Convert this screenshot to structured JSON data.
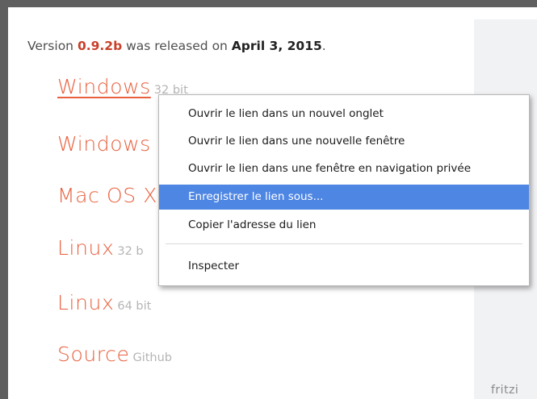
{
  "page": {
    "version_prefix": "Version ",
    "version": "0.9.2b",
    "released_text": " was released on ",
    "date": "April 3, 2015",
    "period": "."
  },
  "downloads": [
    {
      "name": "Windows",
      "meta": "32 bit"
    },
    {
      "name": "Windows",
      "meta": ""
    },
    {
      "name": "Mac OS X",
      "meta": ""
    },
    {
      "name": "Linux",
      "meta": "32 b"
    },
    {
      "name": "Linux",
      "meta": "64 bit"
    },
    {
      "name": "Source",
      "meta": "Github"
    }
  ],
  "sidebar_fragment": "fritzi",
  "context_menu": {
    "items": [
      {
        "label": "Ouvrir le lien dans un nouvel onglet"
      },
      {
        "label": "Ouvrir le lien dans une nouvelle fenêtre"
      },
      {
        "label": "Ouvrir le lien dans une fenêtre en navigation privée"
      },
      {
        "label": "Enregistrer le lien sous...",
        "highlighted": true
      },
      {
        "label": "Copier l'adresse du lien"
      },
      {
        "label": "Inspecter"
      }
    ]
  },
  "colors": {
    "accent": "#e8603e",
    "menu_highlight": "#4e86e4",
    "frame": "#5f5f5f"
  }
}
